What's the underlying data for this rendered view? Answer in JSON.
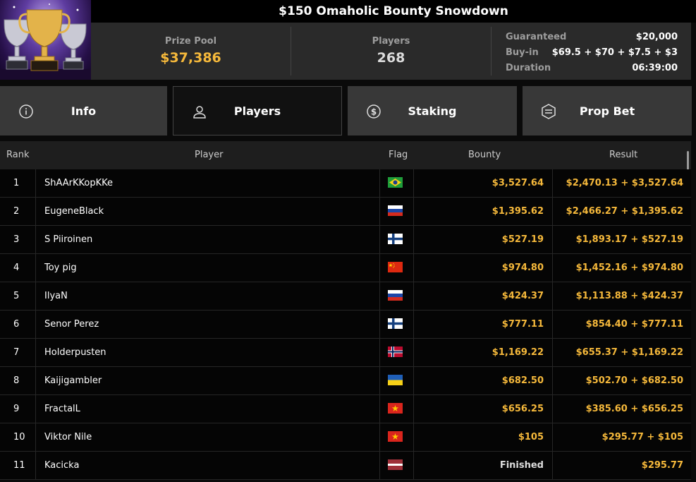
{
  "tournament": {
    "title": "$150 Omaholic Bounty Snowdown"
  },
  "stats": {
    "prize_pool_label": "Prize Pool",
    "prize_pool": "$37,386",
    "players_label": "Players",
    "players": "268",
    "details": [
      {
        "label": "Guaranteed",
        "value": "$20,000"
      },
      {
        "label": "Buy-in",
        "value": "$69.5 + $70 + $7.5 + $3"
      },
      {
        "label": "Duration",
        "value": "06:39:00"
      }
    ]
  },
  "tabs": [
    {
      "label": "Info",
      "icon": "info-icon"
    },
    {
      "label": "Players",
      "icon": "user-icon"
    },
    {
      "label": "Staking",
      "icon": "dollar-icon"
    },
    {
      "label": "Prop Bet",
      "icon": "prop-bet-icon"
    }
  ],
  "table": {
    "headers": {
      "rank": "Rank",
      "player": "Player",
      "flag": "Flag",
      "bounty": "Bounty",
      "result": "Result"
    },
    "rows": [
      {
        "rank": "1",
        "player": "ShAArKKopKKe",
        "flag": "brazil",
        "bounty": "$3,527.64",
        "result": "$2,470.13 + $3,527.64"
      },
      {
        "rank": "2",
        "player": "EugeneBlack",
        "flag": "russia",
        "bounty": "$1,395.62",
        "result": "$2,466.27 + $1,395.62"
      },
      {
        "rank": "3",
        "player": "S Piiroinen",
        "flag": "finland",
        "bounty": "$527.19",
        "result": "$1,893.17 + $527.19"
      },
      {
        "rank": "4",
        "player": "Toy pig",
        "flag": "china",
        "bounty": "$974.80",
        "result": "$1,452.16 + $974.80"
      },
      {
        "rank": "5",
        "player": "IlyaN",
        "flag": "russia",
        "bounty": "$424.37",
        "result": "$1,113.88 + $424.37"
      },
      {
        "rank": "6",
        "player": "Senor Perez",
        "flag": "finland",
        "bounty": "$777.11",
        "result": "$854.40 + $777.11"
      },
      {
        "rank": "7",
        "player": "Holderpusten",
        "flag": "norway",
        "bounty": "$1,169.22",
        "result": "$655.37 + $1,169.22"
      },
      {
        "rank": "8",
        "player": "Kaijigambler",
        "flag": "ukraine",
        "bounty": "$682.50",
        "result": "$502.70 + $682.50"
      },
      {
        "rank": "9",
        "player": "FractalL",
        "flag": "vietnam",
        "bounty": "$656.25",
        "result": "$385.60 + $656.25"
      },
      {
        "rank": "10",
        "player": "Viktor Nile",
        "flag": "vietnam",
        "bounty": "$105",
        "result": "$295.77 + $105"
      },
      {
        "rank": "11",
        "player": "Kacicka",
        "flag": "latvia",
        "bounty": "Finished",
        "result": "$295.77"
      }
    ]
  },
  "colors": {
    "accent_gold": "#f6b93b"
  }
}
